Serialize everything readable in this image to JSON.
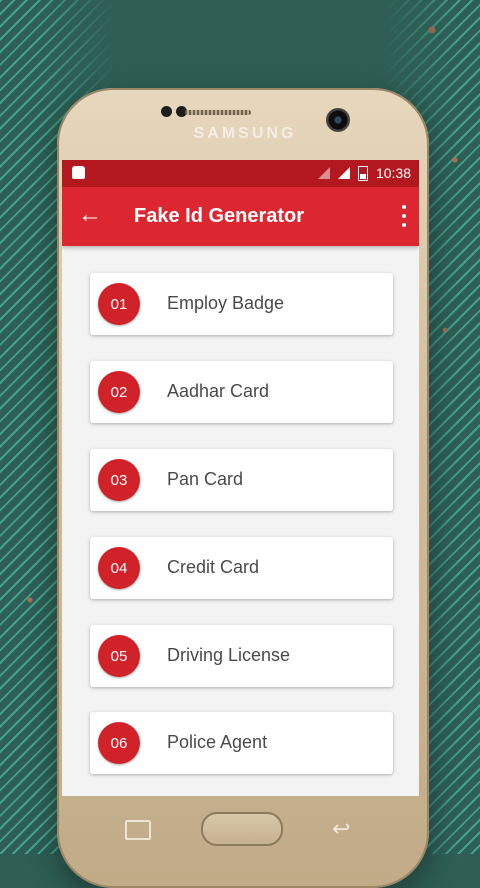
{
  "device": {
    "brand": "SAMSUNG"
  },
  "status_bar": {
    "time": "10:38"
  },
  "app_bar": {
    "title": "Fake Id Generator"
  },
  "menu_items": [
    {
      "number": "01",
      "label": "Employ Badge"
    },
    {
      "number": "02",
      "label": "Aadhar Card"
    },
    {
      "number": "03",
      "label": "Pan Card"
    },
    {
      "number": "04",
      "label": "Credit Card"
    },
    {
      "number": "05",
      "label": "Driving License"
    },
    {
      "number": "06",
      "label": "Police Agent"
    }
  ],
  "colors": {
    "status_bar": "#b4181f",
    "toolbar": "#dc2730",
    "badge": "#d22229"
  }
}
